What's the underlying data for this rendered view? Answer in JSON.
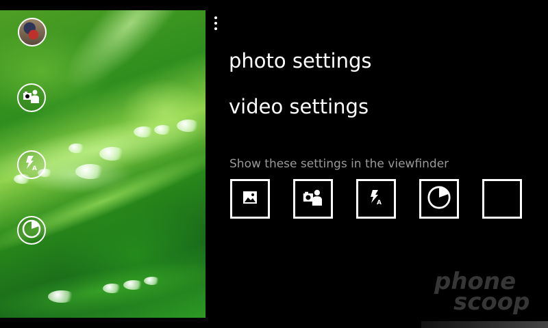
{
  "menu": {
    "items": [
      {
        "label": "photo settings"
      },
      {
        "label": "video settings"
      }
    ]
  },
  "viewfinder_settings": {
    "section_label": "Show these settings in the viewfinder",
    "slots": [
      {
        "icon": "image-icon"
      },
      {
        "icon": "scene-mode-icon"
      },
      {
        "icon": "flash-auto-icon"
      },
      {
        "icon": "timer-icon"
      },
      {
        "icon": "empty-slot"
      }
    ]
  },
  "sidebar": {
    "buttons": [
      {
        "icon": "camera-roll-thumbnail"
      },
      {
        "icon": "scene-mode-icon"
      },
      {
        "icon": "flash-auto-icon"
      },
      {
        "icon": "timer-icon"
      }
    ]
  },
  "watermark": {
    "line1": "phone",
    "line2": "scoop"
  },
  "colors": {
    "background": "#000000",
    "label_gray": "#9a9a9a",
    "foreground": "#ffffff"
  }
}
